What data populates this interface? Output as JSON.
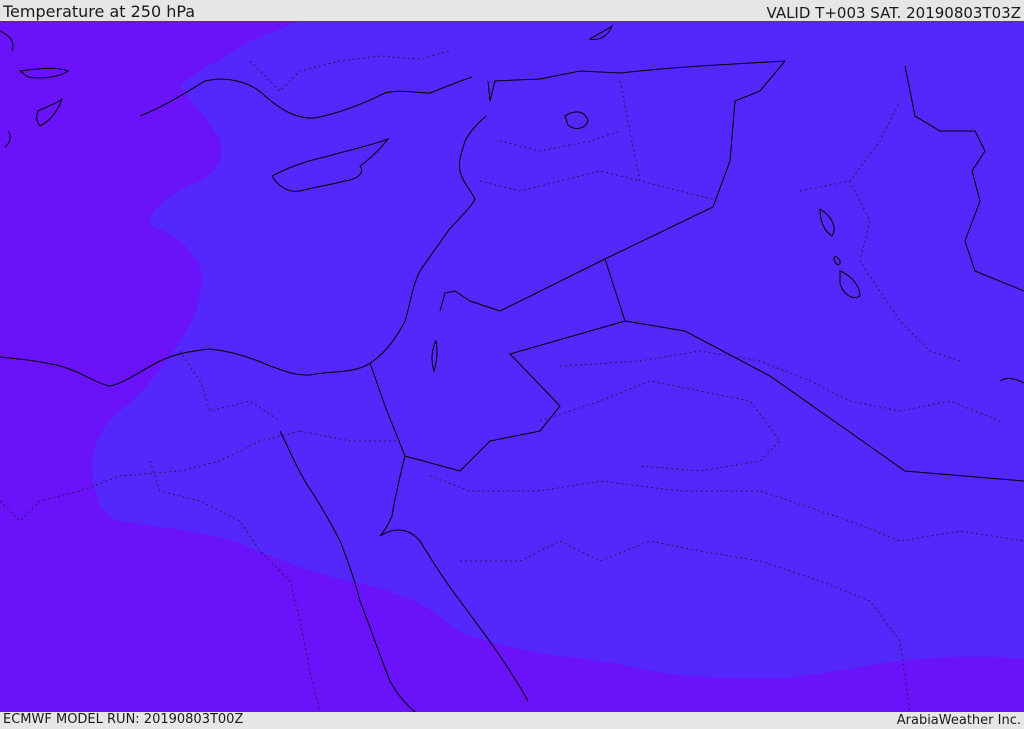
{
  "header": {
    "title": "Temperature at 250 hPa",
    "valid": "VALID T+003 SAT. 20190803T03Z"
  },
  "footer": {
    "model_run": "ECMWF MODEL RUN: 20190803T00Z",
    "credit": "ArabiaWeather Inc."
  },
  "map": {
    "colors": {
      "colder_band": "#6a12fa",
      "warmer_band": "#5428fa",
      "coastline": "#000000",
      "internal_borders": "#1a1a66"
    }
  }
}
